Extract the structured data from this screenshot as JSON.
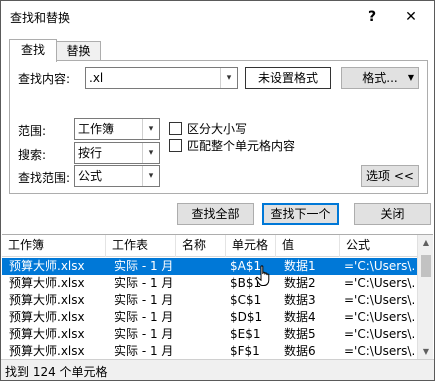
{
  "window": {
    "title": "查找和替换",
    "help": "?",
    "close": "✕"
  },
  "tabs": [
    {
      "label": "查找"
    },
    {
      "label": "替换"
    }
  ],
  "find": {
    "label": "查找内容:",
    "value": ".xl",
    "format_status": "未设置格式",
    "format_button": "格式..."
  },
  "options": {
    "scope_label": "范围:",
    "scope_value": "工作簿",
    "search_label": "搜索:",
    "search_value": "按行",
    "lookin_label": "查找范围:",
    "lookin_value": "公式",
    "match_case": "区分大小写",
    "match_entire": "匹配整个单元格内容",
    "options_button": "选项 <<"
  },
  "actions": {
    "find_all": "查找全部",
    "find_next": "查找下一个",
    "close": "关闭"
  },
  "results": {
    "columns": [
      "工作簿",
      "工作表",
      "名称",
      "单元格",
      "值",
      "公式"
    ],
    "rows": [
      [
        "预算大师.xlsx",
        "实际 - 1 月",
        "",
        "$A$1",
        "数据1",
        "='C:\\Users\\..."
      ],
      [
        "预算大师.xlsx",
        "实际 - 1 月",
        "",
        "$B$1",
        "数据2",
        "='C:\\Users\\..."
      ],
      [
        "预算大师.xlsx",
        "实际 - 1 月",
        "",
        "$C$1",
        "数据3",
        "='C:\\Users\\..."
      ],
      [
        "预算大师.xlsx",
        "实际 - 1 月",
        "",
        "$D$1",
        "数据4",
        "='C:\\Users\\..."
      ],
      [
        "预算大师.xlsx",
        "实际 - 1 月",
        "",
        "$E$1",
        "数据5",
        "='C:\\Users\\..."
      ],
      [
        "预算大师.xlsx",
        "实际 - 1 月",
        "",
        "$F$1",
        "数据6",
        "='C:\\Users\\..."
      ]
    ],
    "selected_row": 0
  },
  "status": {
    "text": "找到 124 个单元格"
  },
  "colors": {
    "accent": "#0078d7",
    "selection": "#0078d7",
    "button_face": "#e1e1e1"
  }
}
